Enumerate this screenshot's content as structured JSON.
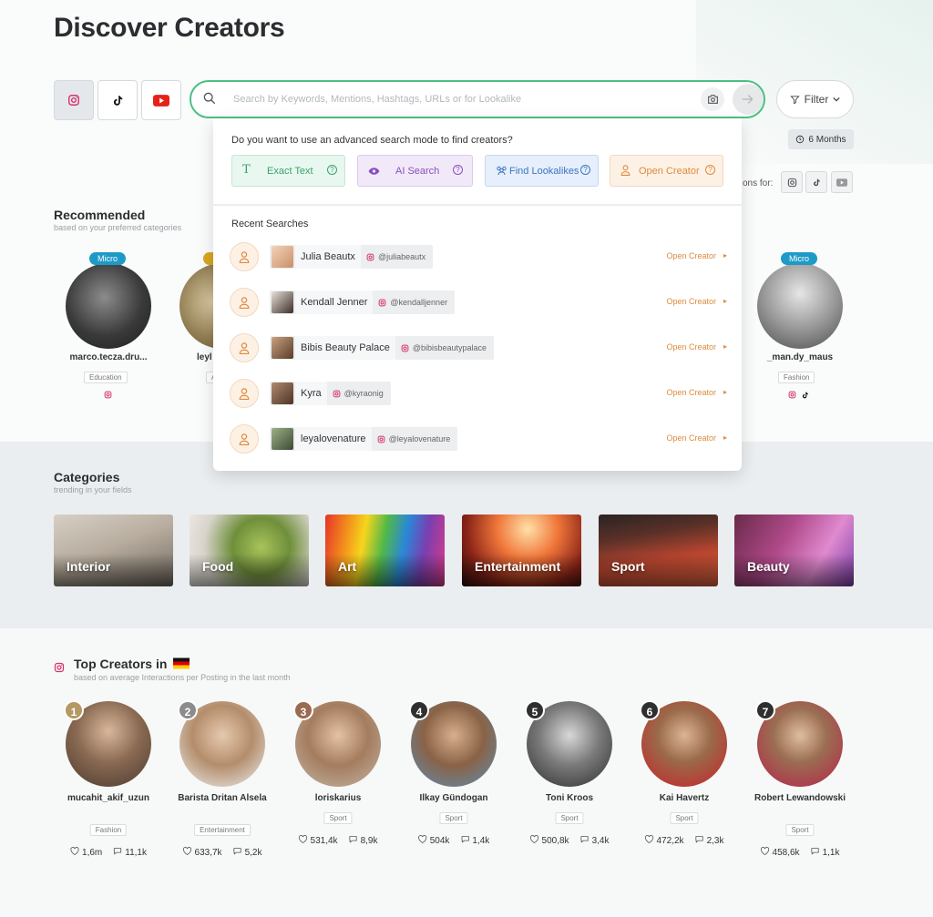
{
  "page": {
    "title": "Discover Creators"
  },
  "platforms": {
    "instagram": "instagram-icon",
    "tiktok": "tiktok-icon",
    "youtube": "youtube-icon"
  },
  "search": {
    "placeholder": "Search by Keywords, Mentions, Hashtags, URLs or for Lookalike"
  },
  "filter": {
    "label": "Filter"
  },
  "timeframe": {
    "label": "6 Months"
  },
  "recommendations_for": {
    "label": "ons for:"
  },
  "dropdown": {
    "question": "Do you want to use an advanced search mode to find creators?",
    "modes": [
      {
        "label": "Exact Text",
        "color": "#3aa36b"
      },
      {
        "label": "AI Search",
        "color": "#8a4fbf"
      },
      {
        "label": "Find Lookalikes",
        "color": "#3d74c5"
      },
      {
        "label": "Open Creator",
        "color": "#df8a3c"
      }
    ],
    "recent_title": "Recent Searches",
    "recent": [
      {
        "name": "Julia Beautx",
        "handle": "@juliabeautx",
        "action": "Open Creator"
      },
      {
        "name": "Kendall Jenner",
        "handle": "@kendalljenner",
        "action": "Open Creator"
      },
      {
        "name": "Bibis Beauty Palace",
        "handle": "@bibisbeautypalace",
        "action": "Open Creator"
      },
      {
        "name": "Kyra",
        "handle": "@kyraonig",
        "action": "Open Creator"
      },
      {
        "name": "leyalovenature",
        "handle": "@leyalovenature",
        "action": "Open Creator"
      }
    ]
  },
  "recommended": {
    "title": "Recommended",
    "subtitle": "based on your preferred categories",
    "creators": [
      {
        "badge": "Micro",
        "name": "marco.tecza.dru...",
        "category": "Education"
      },
      {
        "badge": "",
        "name": "leyl",
        "category": "A"
      },
      {
        "badge": "Micro",
        "name": "_man.dy_maus",
        "category": "Fashion"
      }
    ]
  },
  "categories": {
    "title": "Categories",
    "subtitle": "trending in your fields",
    "items": [
      "Interior",
      "Food",
      "Art",
      "Entertainment",
      "Sport",
      "Beauty"
    ]
  },
  "top_creators": {
    "title": "Top Creators in",
    "subtitle": "based on average Interactions per Posting in the last month",
    "items": [
      {
        "rank": "1",
        "name": "mucahit_akif_uzun",
        "category": "Fashion",
        "likes": "1,6m",
        "comments": "11,1k"
      },
      {
        "rank": "2",
        "name": "Barista Dritan Alsela",
        "category": "Entertainment",
        "likes": "633,7k",
        "comments": "5,2k"
      },
      {
        "rank": "3",
        "name": "loriskarius",
        "category": "Sport",
        "likes": "531,4k",
        "comments": "8,9k"
      },
      {
        "rank": "4",
        "name": "Ilkay Gündogan",
        "category": "Sport",
        "likes": "504k",
        "comments": "1,4k"
      },
      {
        "rank": "5",
        "name": "Toni Kroos",
        "category": "Sport",
        "likes": "500,8k",
        "comments": "3,4k"
      },
      {
        "rank": "6",
        "name": "Kai Havertz",
        "category": "Sport",
        "likes": "472,2k",
        "comments": "2,3k"
      },
      {
        "rank": "7",
        "name": "Robert Lewandowski",
        "category": "Sport",
        "likes": "458,6k",
        "comments": "1,1k"
      }
    ]
  },
  "colors": {
    "accent": "#4cbf84",
    "micro": "#1e9ac7",
    "open_creator": "#df8a3c",
    "instagram": "#d6336c"
  }
}
